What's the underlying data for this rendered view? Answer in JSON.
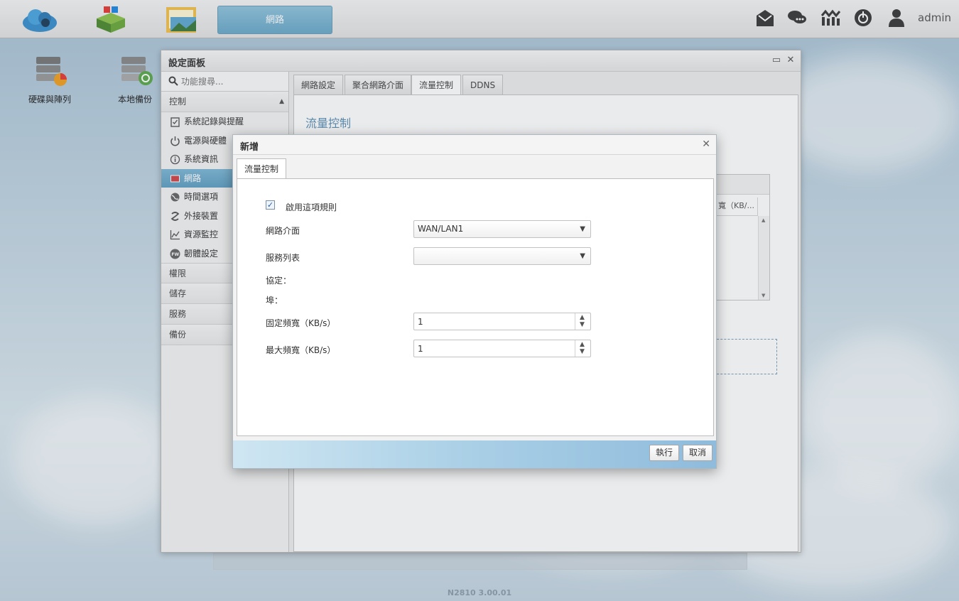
{
  "topbar": {
    "apps": [
      "cloud-app-icon",
      "app-center-icon",
      "file-manager-icon"
    ],
    "active_task": "網路",
    "right_icons": [
      "mail-icon",
      "chat-icon",
      "network-status-icon",
      "power-icon",
      "user-icon"
    ],
    "user": "admin"
  },
  "desktop": {
    "icons": [
      {
        "label": "硬碟與陣列",
        "icon": "disk-array-icon"
      },
      {
        "label": "本地備份",
        "icon": "local-backup-icon"
      }
    ]
  },
  "window": {
    "title": "設定面板",
    "search_placeholder": "功能搜尋...",
    "categories": {
      "control": "控制",
      "privilege": "權限",
      "storage": "儲存",
      "service": "服務",
      "backup": "備份"
    },
    "control_items": [
      {
        "label": "系統記錄與提醒",
        "icon": "log-icon"
      },
      {
        "label": "電源與硬體",
        "icon": "power-icon"
      },
      {
        "label": "系統資訊",
        "icon": "info-icon"
      },
      {
        "label": "網路",
        "icon": "network-icon"
      },
      {
        "label": "時間選項",
        "icon": "globe-icon"
      },
      {
        "label": "外接裝置",
        "icon": "usb-icon"
      },
      {
        "label": "資源監控",
        "icon": "chart-icon"
      },
      {
        "label": "韌體設定",
        "icon": "firmware-icon"
      }
    ],
    "tabs": [
      "網路設定",
      "聚合網路介面",
      "流量控制",
      "DDNS"
    ],
    "selected_tab": "流量控制",
    "content_heading": "流量控制",
    "table_header_partial": "寬（KB/..."
  },
  "dialog": {
    "title": "新增",
    "tab": "流量控制",
    "enable_label": "啟用這項規則",
    "enable_checked": true,
    "fields": {
      "interface_label": "網路介面",
      "interface_value": "WAN/LAN1",
      "service_label": "服務列表",
      "service_value": "",
      "protocol_label": "協定：",
      "port_label": "埠：",
      "fixed_bw_label": "固定頻寬（KB/s）",
      "fixed_bw_value": "1",
      "max_bw_label": "最大頻寬（KB/s）",
      "max_bw_value": "1"
    },
    "apply_label": "執行",
    "cancel_label": "取消"
  },
  "footer": "N2810   3.00.01"
}
